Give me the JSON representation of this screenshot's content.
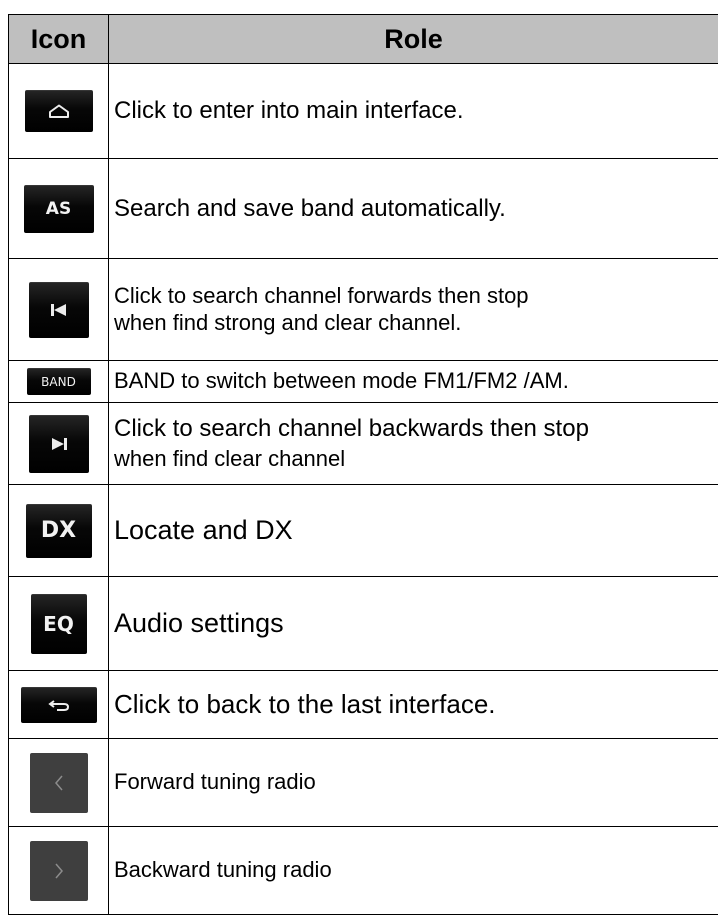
{
  "table": {
    "headers": {
      "icon": "Icon",
      "role": "Role"
    },
    "rows": [
      {
        "icon": "home-icon",
        "icon_text": "",
        "role_lines": [
          "Click to enter into main interface."
        ]
      },
      {
        "icon": "as-icon",
        "icon_text": "AS",
        "role_lines": [
          "Search and save band automatically."
        ]
      },
      {
        "icon": "seek-back-icon",
        "icon_text": "",
        "role_lines": [
          "Click to search channel forwards then stop",
          "when find strong and clear channel."
        ]
      },
      {
        "icon": "band-icon",
        "icon_text": "BAND",
        "role_lines": [
          "BAND to switch between mode FM1/FM2 /AM."
        ]
      },
      {
        "icon": "seek-forward-icon",
        "icon_text": "",
        "role_lines": [
          "Click to search channel backwards then stop",
          "when find clear channel"
        ]
      },
      {
        "icon": "dx-icon",
        "icon_text": "DX",
        "role_lines": [
          "Locate and DX"
        ]
      },
      {
        "icon": "eq-icon",
        "icon_text": "EQ",
        "role_lines": [
          "Audio settings"
        ]
      },
      {
        "icon": "back-icon",
        "icon_text": "",
        "role_lines": [
          "Click to back to the last interface."
        ]
      },
      {
        "icon": "chevron-left-icon",
        "icon_text": "",
        "role_lines": [
          "Forward tuning radio"
        ]
      },
      {
        "icon": "chevron-right-icon",
        "icon_text": "",
        "role_lines": [
          "Backward tuning radio"
        ]
      }
    ]
  }
}
